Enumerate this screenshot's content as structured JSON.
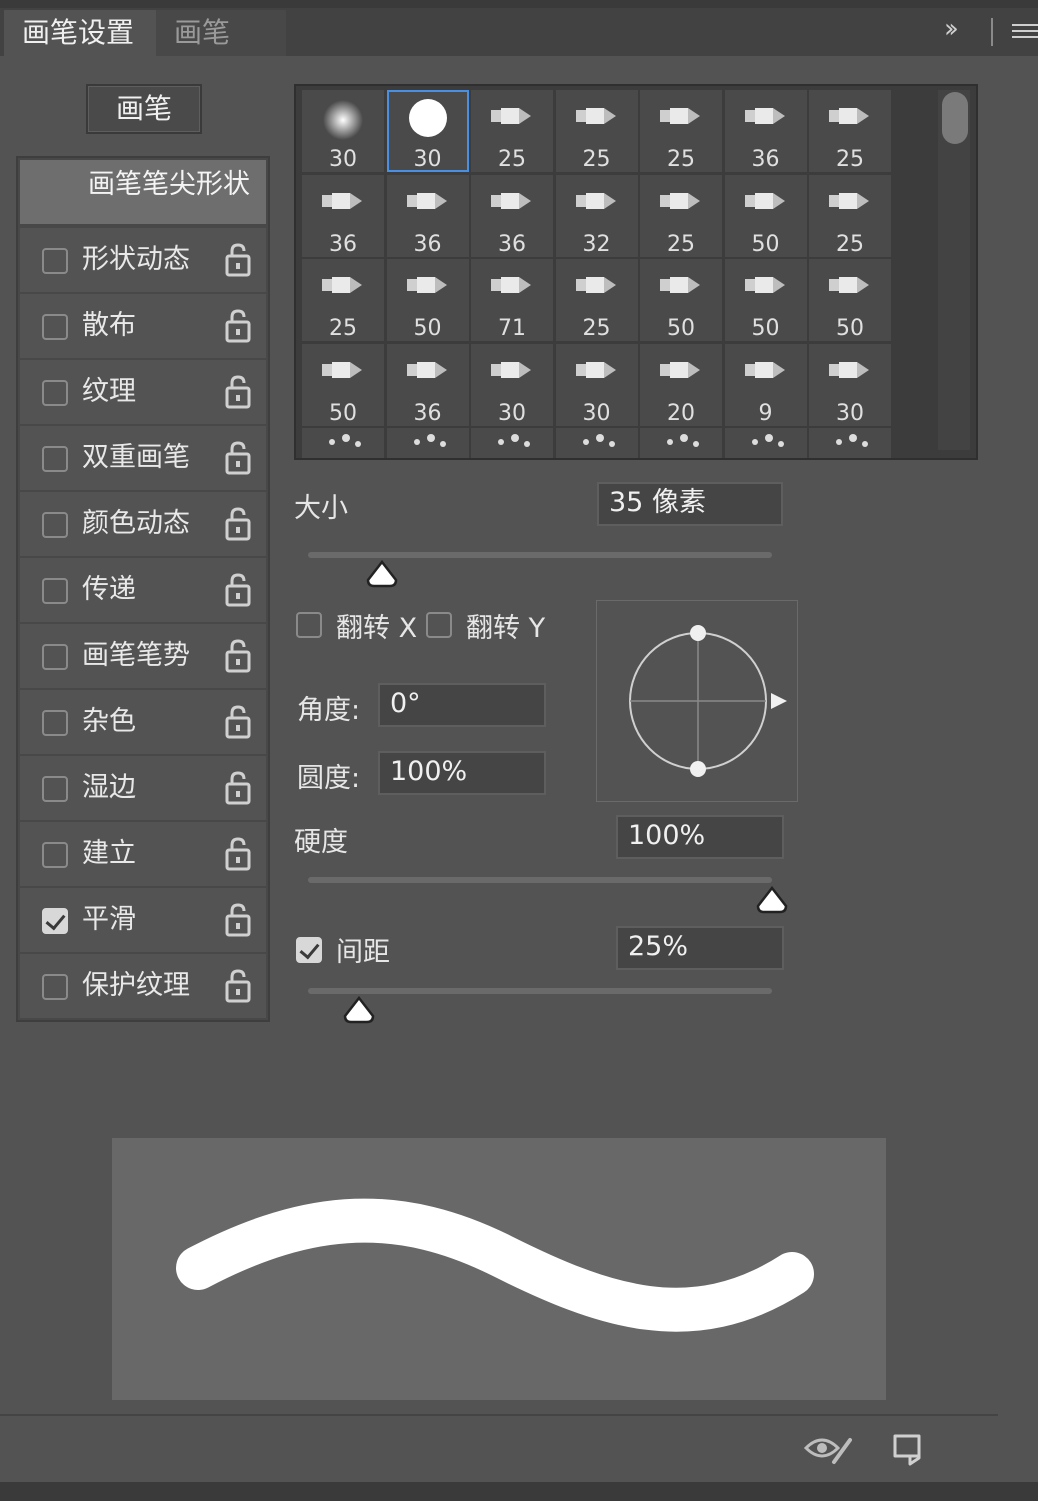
{
  "tabs": {
    "brush_settings": "画笔设置",
    "brushes": "画笔"
  },
  "toolbar": {
    "collapse": "››",
    "menu_icon": "hamburger-menu-icon"
  },
  "brush_button": "画笔",
  "brush_tip_shape": "画笔笔尖形状",
  "options": [
    {
      "label": "形状动态",
      "checked": false
    },
    {
      "label": "散布",
      "checked": false
    },
    {
      "label": "纹理",
      "checked": false
    },
    {
      "label": "双重画笔",
      "checked": false
    },
    {
      "label": "颜色动态",
      "checked": false
    },
    {
      "label": "传递",
      "checked": false
    },
    {
      "label": "画笔笔势",
      "checked": false
    },
    {
      "label": "杂色",
      "checked": false
    },
    {
      "label": "湿边",
      "checked": false
    },
    {
      "label": "建立",
      "checked": false
    },
    {
      "label": "平滑",
      "checked": true
    },
    {
      "label": "保护纹理",
      "checked": false
    }
  ],
  "brush_sizes": [
    [
      "30",
      "30",
      "25",
      "25",
      "25",
      "36",
      "25"
    ],
    [
      "36",
      "36",
      "36",
      "32",
      "25",
      "50",
      "25"
    ],
    [
      "25",
      "50",
      "71",
      "25",
      "50",
      "50",
      "50"
    ],
    [
      "50",
      "36",
      "30",
      "30",
      "20",
      "9",
      "30"
    ]
  ],
  "selected_brush": {
    "row": 0,
    "col": 1
  },
  "size": {
    "label": "大小",
    "value": "35 像素",
    "slider_fraction": 0.16
  },
  "flip_x": {
    "label": "翻转 X",
    "checked": false
  },
  "flip_y": {
    "label": "翻转 Y",
    "checked": false
  },
  "angle": {
    "label": "角度:",
    "value": "0°"
  },
  "roundness": {
    "label": "圆度:",
    "value": "100%"
  },
  "hardness": {
    "label": "硬度",
    "value": "100%",
    "slider_fraction": 1.0
  },
  "spacing": {
    "label": "间距",
    "value": "25%",
    "checked": true,
    "slider_fraction": 0.11
  },
  "colors": {
    "panel": "#535353",
    "selected_outline": "#4a90e2",
    "preview_bg": "#686868",
    "stroke": "#ffffff"
  }
}
